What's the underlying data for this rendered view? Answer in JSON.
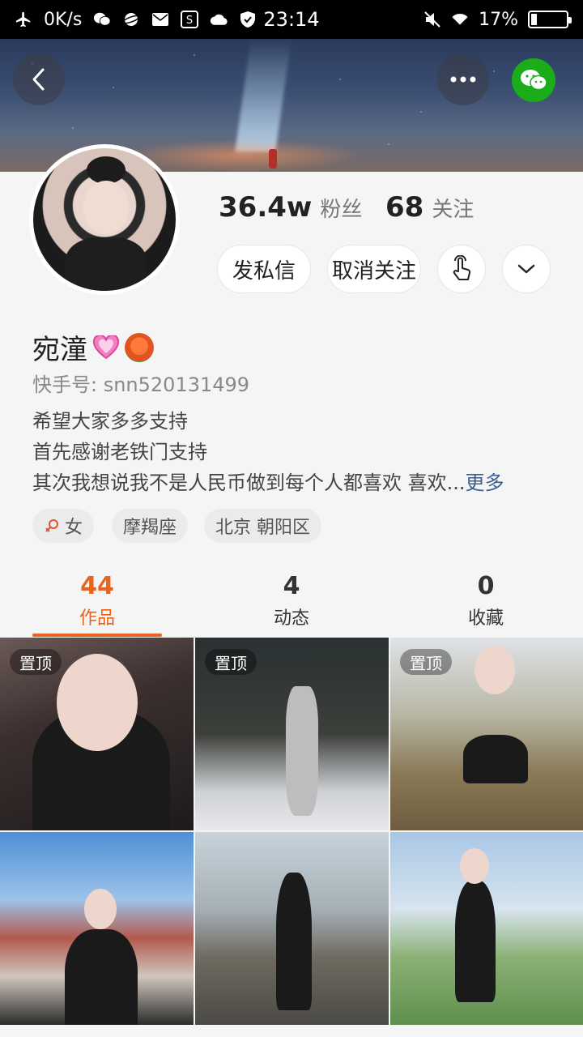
{
  "status_bar": {
    "net_speed": "0K/s",
    "time": "23:14",
    "battery": "17%",
    "battery_level": 0.17
  },
  "header": {
    "back_icon": "chevron-left-icon",
    "more_icon": "ellipsis-icon",
    "wechat_icon": "wechat-icon",
    "wechat_color": "#1aad19"
  },
  "profile": {
    "fans_count": "36.4w",
    "fans_label": "粉丝",
    "following_count": "68",
    "following_label": "关注",
    "message_button": "发私信",
    "unfollow_button": "取消关注",
    "name": "宛潼",
    "kuaishou_id": "快手号: snn520131499",
    "bio_lines": [
      "希望大家多多支持",
      "首先感谢老铁门支持",
      "其次我想说我不是人民币做到每个人都喜欢 喜欢..."
    ],
    "more_link": "更多",
    "tags": {
      "gender": "女",
      "zodiac": "摩羯座",
      "location": "北京 朝阳区"
    }
  },
  "tabs": [
    {
      "count": "44",
      "label": "作品",
      "active": true
    },
    {
      "count": "4",
      "label": "动态",
      "active": false
    },
    {
      "count": "0",
      "label": "收藏",
      "active": false
    }
  ],
  "accent_color": "#e8641c",
  "grid": {
    "pinned_label": "置顶"
  }
}
